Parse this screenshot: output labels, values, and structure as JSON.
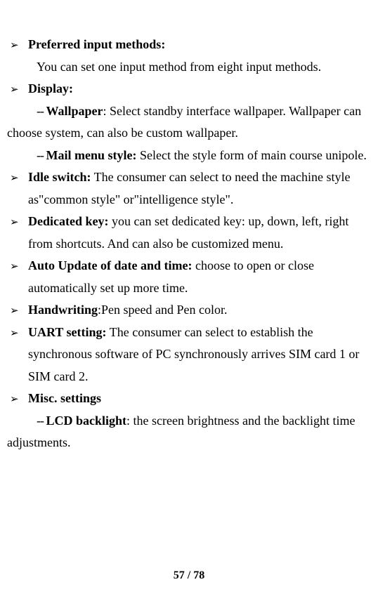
{
  "bullet_glyph": "➢",
  "items": {
    "preferred_input": {
      "title": "Preferred input methods:",
      "desc": "You can set one input method from eight input methods."
    },
    "display": {
      "title": "Display:",
      "wallpaper_dash": "-- ",
      "wallpaper_label": "Wallpaper",
      "wallpaper_desc": ": Select standby interface wallpaper. Wallpaper can choose system, can also be custom wallpaper.",
      "mail_dash": "-- ",
      "mail_label": "Mail menu style:",
      "mail_desc": " Select the style form of main course unipole."
    },
    "idle_switch": {
      "title": "Idle switch:",
      "desc": " The consumer can select to need the machine style as\"common style\" or\"intelligence style\"."
    },
    "dedicated_key": {
      "title": "Dedicated key:",
      "desc": " you can set dedicated key: up, down, left, right from shortcuts. And can also be customized menu."
    },
    "auto_update": {
      "title": "Auto Update of date and time:",
      "desc": " choose to open or close automatically set up more time."
    },
    "handwriting": {
      "title": "Handwriting",
      "desc": ":Pen speed and Pen color."
    },
    "uart": {
      "title": "UART setting:",
      "desc": " The consumer can select to establish the synchronous software of PC synchronously arrives SIM card 1 or SIM card 2."
    },
    "misc": {
      "title": "Misc. settings",
      "lcd_dash": "-- ",
      "lcd_label": "LCD backlight",
      "lcd_desc": ": the screen brightness and the backlight time adjustments."
    }
  },
  "footer": "57 / 78"
}
